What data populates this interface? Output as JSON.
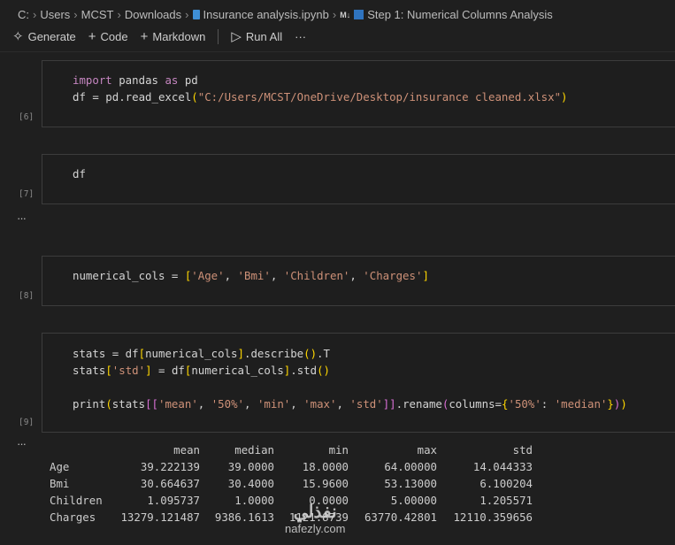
{
  "breadcrumb": [
    "C:",
    "Users",
    "MCST",
    "Downloads",
    "Insurance analysis.ipynb",
    "Step 1: Numerical Columns Analysis"
  ],
  "markdown_badge": "M↓",
  "toolbar": {
    "generate": "Generate",
    "code": "Code",
    "markdown": "Markdown",
    "run_all": "Run All",
    "more": "···"
  },
  "cells": [
    {
      "count": "[6]",
      "lines": [
        [
          [
            "import",
            "kw"
          ],
          [
            " pandas ",
            ""
          ],
          [
            "as",
            "kw"
          ],
          [
            " pd",
            ""
          ]
        ],
        [
          [
            "df = pd.read_excel",
            ""
          ],
          [
            "(",
            "br"
          ],
          [
            "\"C:/Users/MCST/OneDrive/Desktop/insurance cleaned.xlsx\"",
            "str"
          ],
          [
            ")",
            "br"
          ]
        ]
      ]
    },
    {
      "count": "[7]",
      "lines": [
        [
          [
            "df",
            ""
          ]
        ]
      ]
    },
    {
      "count": "[8]",
      "lines": [
        [
          [
            "numerical_cols = ",
            ""
          ],
          [
            "[",
            "br"
          ],
          [
            "'Age'",
            "str"
          ],
          [
            ", ",
            ""
          ],
          [
            "'Bmi'",
            "str"
          ],
          [
            ", ",
            ""
          ],
          [
            "'Children'",
            "str"
          ],
          [
            ", ",
            ""
          ],
          [
            "'Charges'",
            "str"
          ],
          [
            "]",
            "br"
          ]
        ]
      ]
    },
    {
      "count": "[9]",
      "lines": [
        [
          [
            "stats = df",
            ""
          ],
          [
            "[",
            "br"
          ],
          [
            "numerical_cols",
            ""
          ],
          [
            "]",
            "br"
          ],
          [
            ".describe",
            ""
          ],
          [
            "()",
            "br"
          ],
          [
            ".T",
            ""
          ]
        ],
        [
          [
            "stats",
            ""
          ],
          [
            "[",
            "br"
          ],
          [
            "'std'",
            "str"
          ],
          [
            "]",
            "br"
          ],
          [
            " = df",
            ""
          ],
          [
            "[",
            "br"
          ],
          [
            "numerical_cols",
            ""
          ],
          [
            "]",
            "br"
          ],
          [
            ".std",
            ""
          ],
          [
            "()",
            "br"
          ]
        ],
        [],
        [
          [
            "print",
            ""
          ],
          [
            "(",
            "br"
          ],
          [
            "stats",
            ""
          ],
          [
            "[[",
            "br2"
          ],
          [
            "'mean'",
            "str"
          ],
          [
            ", ",
            ""
          ],
          [
            "'50%'",
            "str"
          ],
          [
            ", ",
            ""
          ],
          [
            "'min'",
            "str"
          ],
          [
            ", ",
            ""
          ],
          [
            "'max'",
            "str"
          ],
          [
            ", ",
            ""
          ],
          [
            "'std'",
            "str"
          ],
          [
            "]]",
            "br2"
          ],
          [
            ".rename",
            ""
          ],
          [
            "(",
            "br2"
          ],
          [
            "columns=",
            ""
          ],
          [
            "{",
            "br"
          ],
          [
            "'50%'",
            "str"
          ],
          [
            ": ",
            ""
          ],
          [
            "'median'",
            "str"
          ],
          [
            "}",
            "br"
          ],
          [
            ")",
            "br2"
          ],
          [
            ")",
            "br"
          ]
        ]
      ]
    }
  ],
  "output": {
    "columns": [
      "",
      "mean",
      "median",
      "min",
      "max",
      "std"
    ],
    "rows": [
      [
        "Age",
        "39.222139",
        "39.0000",
        "18.0000",
        "64.00000",
        "14.044333"
      ],
      [
        "Bmi",
        "30.664637",
        "30.4000",
        "15.9600",
        "53.13000",
        "6.100204"
      ],
      [
        "Children",
        "1.095737",
        "1.0000",
        "0.0000",
        "5.00000",
        "1.205571"
      ],
      [
        "Charges",
        "13279.121487",
        "9386.1613",
        "1121.8739",
        "63770.42801",
        "12110.359656"
      ]
    ]
  },
  "watermark": {
    "arabic": "نفذلي",
    "latin": "nafezly.com"
  }
}
